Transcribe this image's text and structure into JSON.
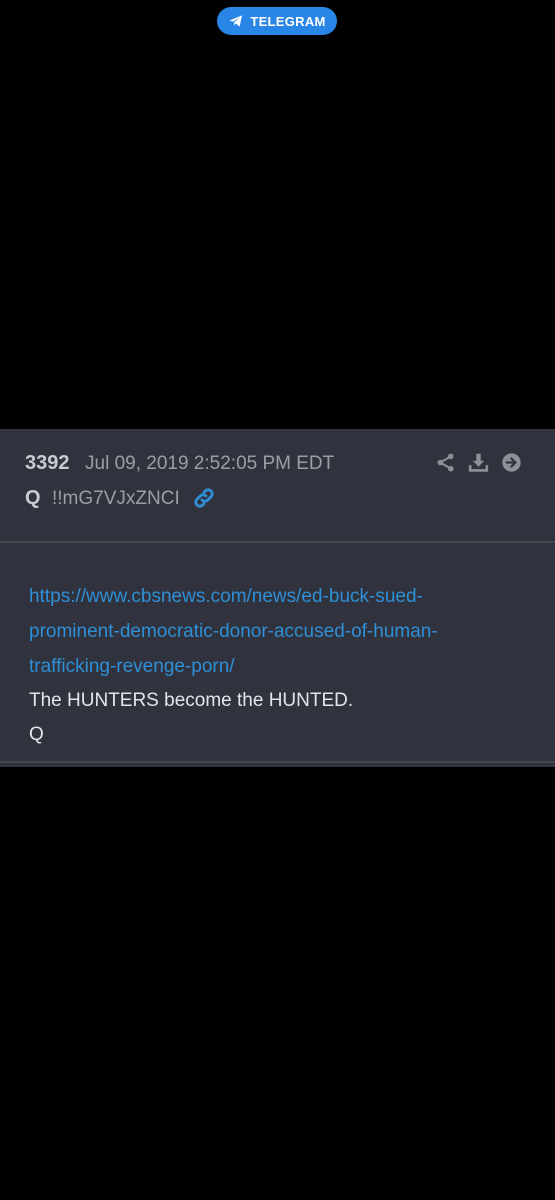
{
  "telegram": {
    "label": "TELEGRAM",
    "icon": "telegram-paper-plane-icon",
    "color": "#2a86e6"
  },
  "post": {
    "number": "3392",
    "date": "Jul 09, 2019 2:52:05 PM EDT",
    "author": "Q",
    "tripcode": "!!mG7VJxZNCI",
    "header_icons": [
      "share-icon",
      "download-icon",
      "arrow-right-circle-icon"
    ],
    "link_icon": "link-icon",
    "link_lines": [
      "https://www.cbsnews.com/news/ed-buck-sued-",
      "prominent-democratic-donor-accused-of-human-",
      "trafficking-revenge-porn/"
    ],
    "body_lines": [
      "The HUNTERS become the HUNTED.",
      "Q"
    ]
  },
  "colors": {
    "background": "#000000",
    "card": "#30333d",
    "link": "#2f8fd6",
    "text": "#e3e5ea",
    "muted": "#9a9ea6"
  }
}
